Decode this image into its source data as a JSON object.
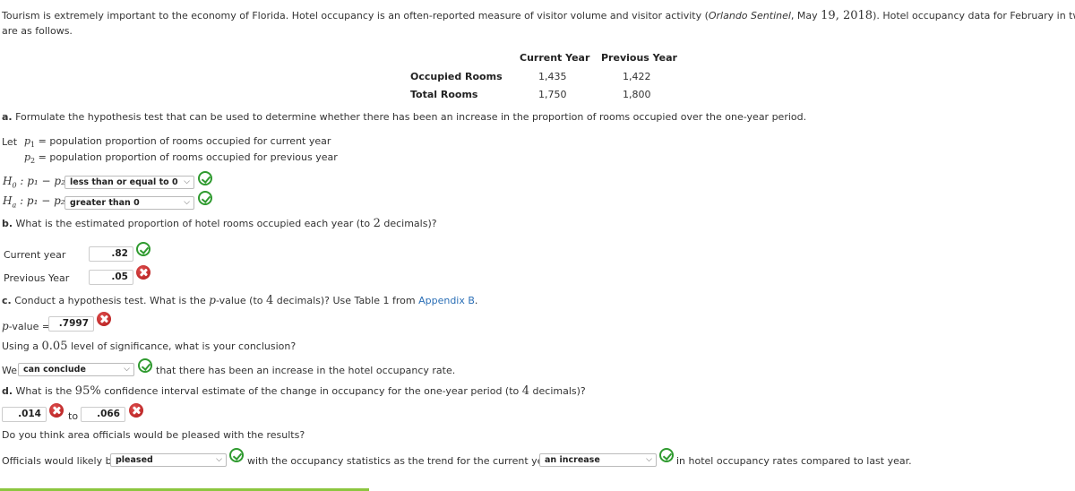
{
  "intro": {
    "line1_a": "Tourism is extremely important to the economy of Florida. Hotel occupancy is an often-reported measure of visitor volume and visitor activity (",
    "source": "Orlando Sentinel",
    "line1_b": ", May ",
    "day": "19",
    "comma": ", ",
    "year": "2018",
    "line1_c": "). Hotel occupancy data for February in two consecutive years",
    "line2": "are as follows."
  },
  "table": {
    "headers": [
      "Current Year",
      "Previous Year"
    ],
    "rows": [
      {
        "label": "Occupied Rooms",
        "values": [
          "1,435",
          "1,422"
        ]
      },
      {
        "label": "Total Rooms",
        "values": [
          "1,750",
          "1,800"
        ]
      }
    ]
  },
  "part_a": {
    "letter": "a.",
    "question": " Formulate the hypothesis test that can be used to determine whether there has been an increase in the proportion of rooms occupied over the one-year period.",
    "let": "Let",
    "p1": "p",
    "p1_sub": "1",
    "p2": "p",
    "p2_sub": "2",
    "eq": " = ",
    "p1_def": "population proportion of rooms occupied for current year",
    "p2_def": "population proportion of rooms occupied for previous year",
    "h0_label": "H",
    "h0_sub": "0",
    "ha_label": "H",
    "ha_sub": "a",
    "expr": " : p₁ − p₂",
    "h0_selected": "less than or equal to 0",
    "h0_status": "correct",
    "ha_selected": "greater than 0",
    "ha_status": "correct"
  },
  "part_b": {
    "letter": "b.",
    "question_a": " What is the estimated proportion of hotel rooms occupied each year (to ",
    "decimals": "2",
    "question_b": " decimals)?",
    "current_label": "Current year",
    "current_value": ".82",
    "current_status": "correct",
    "previous_label": "Previous Year",
    "previous_value": ".05",
    "previous_status": "incorrect"
  },
  "part_c": {
    "letter": "c.",
    "question_a": " Conduct a hypothesis test. What is the ",
    "p": "p",
    "question_b": "-value (to ",
    "decimals": "4",
    "question_c": " decimals)? Use Table 1 from ",
    "link": "Appendix B",
    "question_d": ".",
    "pvalue_label_p": "p",
    "pvalue_label": "-value =",
    "pvalue_value": ".7997",
    "pvalue_status": "incorrect",
    "significance_a": "Using a ",
    "alpha": "0.05",
    "significance_b": " level of significance, what is your conclusion?",
    "we": "We",
    "conclusion_selected": "can conclude",
    "conclusion_status": "correct",
    "conclusion_tail": "that there has been an increase in the hotel occupancy rate."
  },
  "part_d": {
    "letter": "d.",
    "question_a": " What is the ",
    "conf": "95%",
    "question_b": " confidence interval estimate of the change in occupancy for the one-year period (to ",
    "decimals": "4",
    "question_c": " decimals)?",
    "lower_value": ".014",
    "lower_status": "incorrect",
    "to": "to",
    "upper_value": ".066",
    "upper_status": "incorrect",
    "pleased_question": "Do you think area officials would be pleased with the results?",
    "officials_label": "Officials would likely be",
    "pleased_selected": "pleased",
    "pleased_status": "correct",
    "middle_text": "with the occupancy statistics as the trend for the current year is",
    "trend_selected": "an increase",
    "trend_status": "correct",
    "tail_text": "in hotel occupancy rates compared to last year."
  },
  "icons": {
    "chevron": "⌵"
  }
}
